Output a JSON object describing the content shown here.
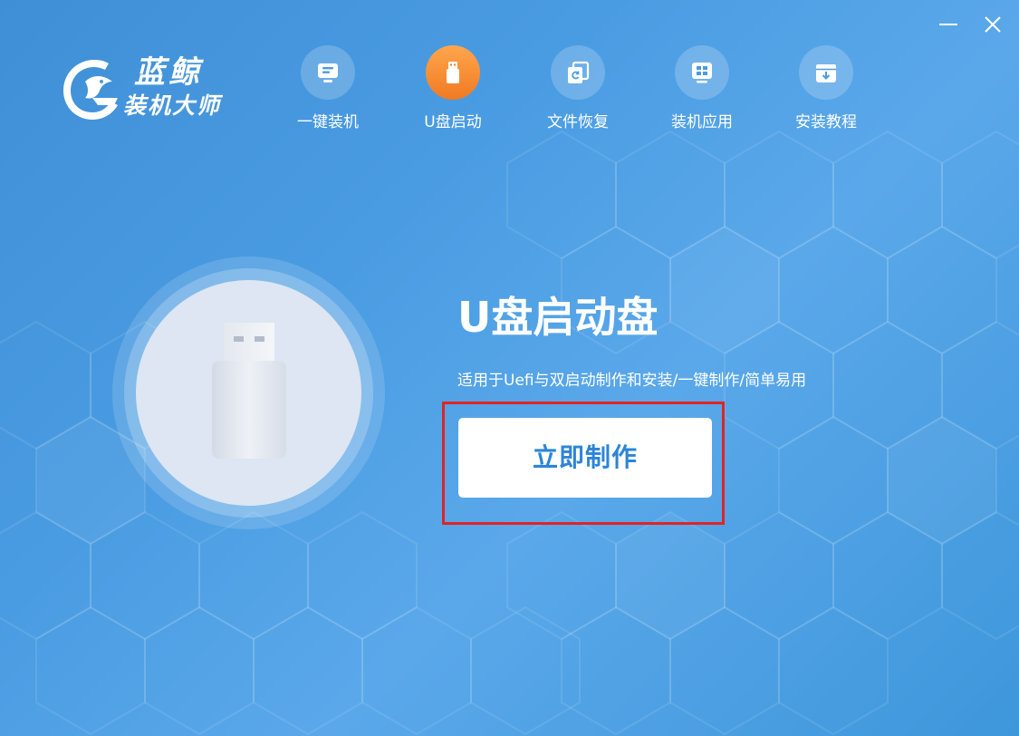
{
  "app": {
    "logo_title": "蓝鲸",
    "logo_subtitle": "装机大师"
  },
  "window_controls": {
    "minimize_icon": "minimize-icon",
    "close_icon": "close-icon"
  },
  "nav": {
    "active_index": 1,
    "items": [
      {
        "label": "一键装机",
        "icon": "monitor-icon"
      },
      {
        "label": "U盘启动",
        "icon": "usb-drive-icon"
      },
      {
        "label": "文件恢复",
        "icon": "file-restore-icon"
      },
      {
        "label": "装机应用",
        "icon": "apps-grid-icon"
      },
      {
        "label": "安装教程",
        "icon": "download-box-icon"
      }
    ]
  },
  "main": {
    "title": "U盘启动盘",
    "description": "适用于Uefi与双启动制作和安装/一键制作/简单易用",
    "action_button": "立即制作",
    "illustration": "usb-drive-illustration"
  },
  "colors": {
    "background": "#4a9ce2",
    "active_nav": "#f38226",
    "button_text": "#2c85d8",
    "highlight_border": "#e02424"
  }
}
